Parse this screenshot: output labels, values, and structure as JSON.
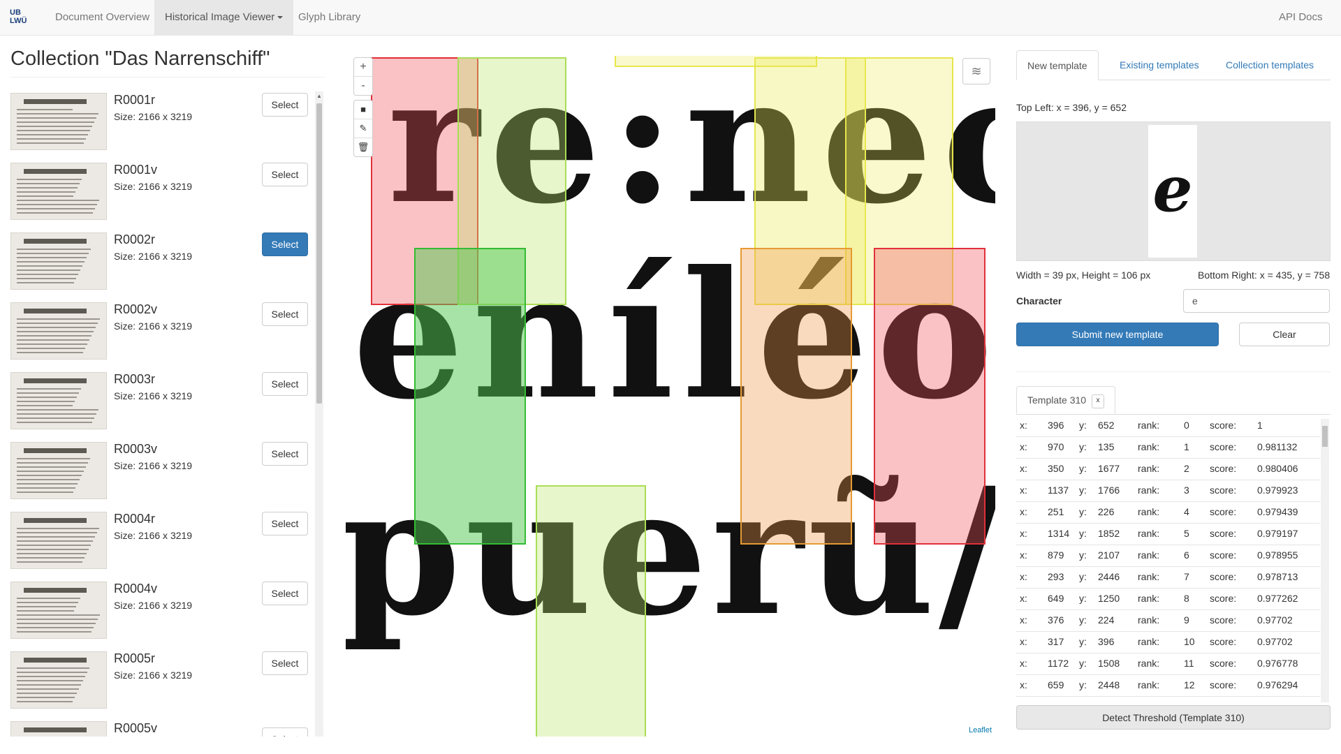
{
  "nav": {
    "brand_top": "UB",
    "brand_bottom": "LWÜ",
    "items": [
      "Document Overview",
      "Historical Image Viewer",
      "Glyph Library"
    ],
    "right": "API Docs"
  },
  "collection": {
    "title": "Collection \"Das Narrenschiff\"",
    "select_label": "Select",
    "items": [
      {
        "name": "R0001r",
        "size": "Size: 2166 x 3219"
      },
      {
        "name": "R0001v",
        "size": "Size: 2166 x 3219"
      },
      {
        "name": "R0002r",
        "size": "Size: 2166 x 3219",
        "selected": true
      },
      {
        "name": "R0002v",
        "size": "Size: 2166 x 3219"
      },
      {
        "name": "R0003r",
        "size": "Size: 2166 x 3219"
      },
      {
        "name": "R0003v",
        "size": "Size: 2166 x 3219"
      },
      {
        "name": "R0004r",
        "size": "Size: 2166 x 3219"
      },
      {
        "name": "R0004v",
        "size": "Size: 2166 x 3219"
      },
      {
        "name": "R0005r",
        "size": "Size: 2166 x 3219"
      },
      {
        "name": "R0005v",
        "size": ""
      }
    ]
  },
  "map": {
    "zoom_in": "+",
    "zoom_out": "-",
    "attribution": "Leaflet",
    "line1": "re:nec",
    "line2": "eníléo",
    "line3": "puerũ/f",
    "colors": {
      "red": "#e0303a",
      "green": "#33bb33",
      "lightgreen": "#aadd55",
      "orange": "#e69a33",
      "yellow": "#e6e64d"
    }
  },
  "template_panel": {
    "tabs": [
      "New template",
      "Existing templates",
      "Collection templates"
    ],
    "top_left": "Top Left: x = 396, y = 652",
    "preview_char": "e",
    "dimensions": "Width = 39 px, Height = 106 px",
    "bottom_right": "Bottom Right: x = 435, y = 758",
    "character_label": "Character",
    "character_value": "e",
    "submit_label": "Submit new template",
    "clear_label": "Clear",
    "template_tab": "Template 310",
    "template_close": "x",
    "results": [
      {
        "x": "396",
        "y": "652",
        "rank": "0",
        "score": "1"
      },
      {
        "x": "970",
        "y": "135",
        "rank": "1",
        "score": "0.981132"
      },
      {
        "x": "350",
        "y": "1677",
        "rank": "2",
        "score": "0.980406"
      },
      {
        "x": "1137",
        "y": "1766",
        "rank": "3",
        "score": "0.979923"
      },
      {
        "x": "251",
        "y": "226",
        "rank": "4",
        "score": "0.979439"
      },
      {
        "x": "1314",
        "y": "1852",
        "rank": "5",
        "score": "0.979197"
      },
      {
        "x": "879",
        "y": "2107",
        "rank": "6",
        "score": "0.978955"
      },
      {
        "x": "293",
        "y": "2446",
        "rank": "7",
        "score": "0.978713"
      },
      {
        "x": "649",
        "y": "1250",
        "rank": "8",
        "score": "0.977262"
      },
      {
        "x": "376",
        "y": "224",
        "rank": "9",
        "score": "0.97702"
      },
      {
        "x": "317",
        "y": "396",
        "rank": "10",
        "score": "0.97702"
      },
      {
        "x": "1172",
        "y": "1508",
        "rank": "11",
        "score": "0.976778"
      },
      {
        "x": "659",
        "y": "2448",
        "rank": "12",
        "score": "0.976294"
      }
    ],
    "detect_label": "Detect Threshold (Template 310)"
  }
}
